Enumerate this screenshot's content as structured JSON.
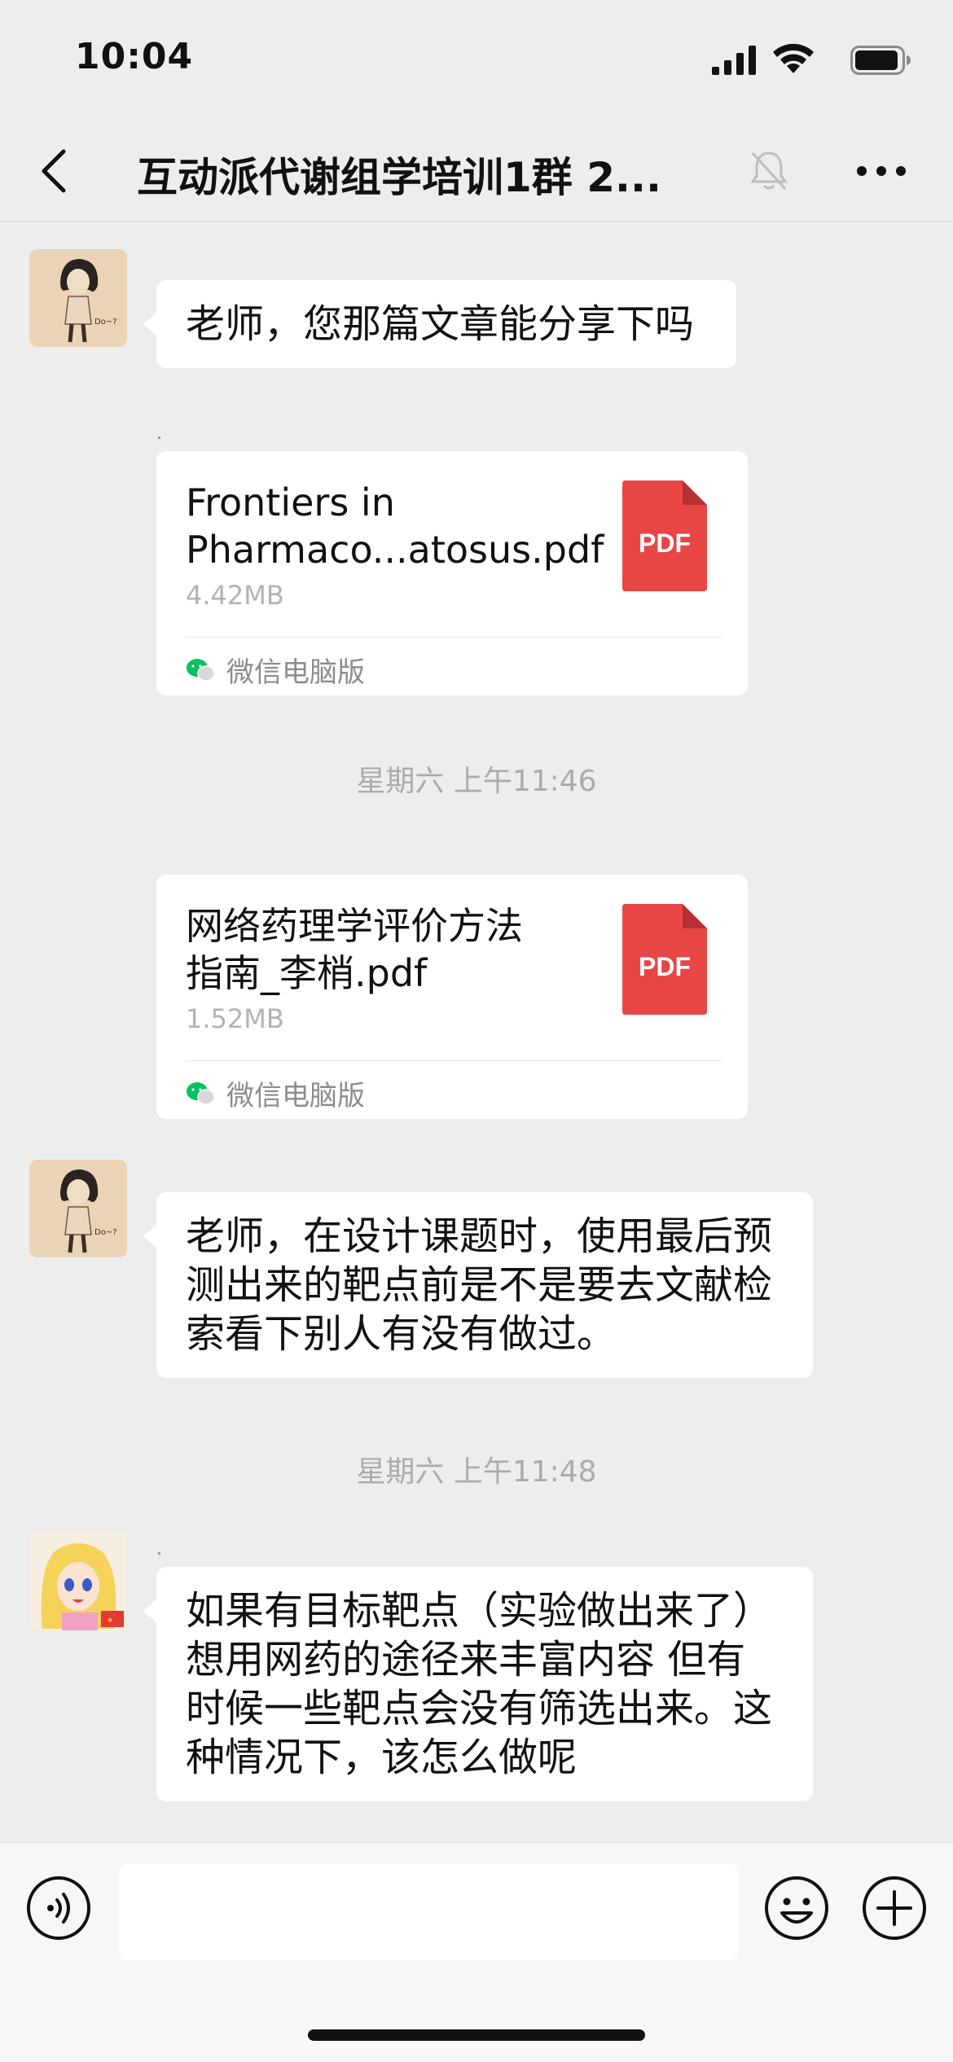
{
  "status_bar": {
    "time": "10:04",
    "icons": [
      "signal-icon",
      "wifi-icon",
      "battery-icon"
    ]
  },
  "header": {
    "title": "互动派代谢组学培训1群 2...",
    "icons": [
      "back-icon",
      "mute-icon",
      "more-icon"
    ]
  },
  "messages": {
    "m1": {
      "text": "老师，您那篇文章能分享下吗"
    },
    "file1": {
      "name_line1": "Frontiers in",
      "name_line2": "Pharmaco...atosus.pdf",
      "size": "4.42MB",
      "badge": "PDF",
      "source": "微信电脑版"
    },
    "time1": "星期六 上午11:46",
    "file2": {
      "name_line1": "网络药理学评价方法",
      "name_line2": "指南_李梢.pdf",
      "size": "1.52MB",
      "badge": "PDF",
      "source": "微信电脑版"
    },
    "m2": {
      "line1": "老师，在设计课题时，使用最后预",
      "line2": "测出来的靶点前是不是要去文献检",
      "line3": "索看下别人有没有做过。"
    },
    "time2": "星期六 上午11:48",
    "m3": {
      "line1": "如果有目标靶点（实验做出来了）",
      "line2": "想用网药的途径来丰富内容 但有",
      "line3": "时候一些靶点会没有筛选出来。这",
      "line4": "种情况下，该怎么做呢"
    }
  },
  "input_bar": {
    "icons": [
      "voice-icon",
      "emoji-icon",
      "plus-icon"
    ],
    "value": ""
  },
  "colors": {
    "background": "#EDEDED",
    "bubble": "#FFFFFF",
    "pdf_red": "#E84545",
    "wechat_green": "#07C160",
    "timestamp": "#ABABAB"
  }
}
